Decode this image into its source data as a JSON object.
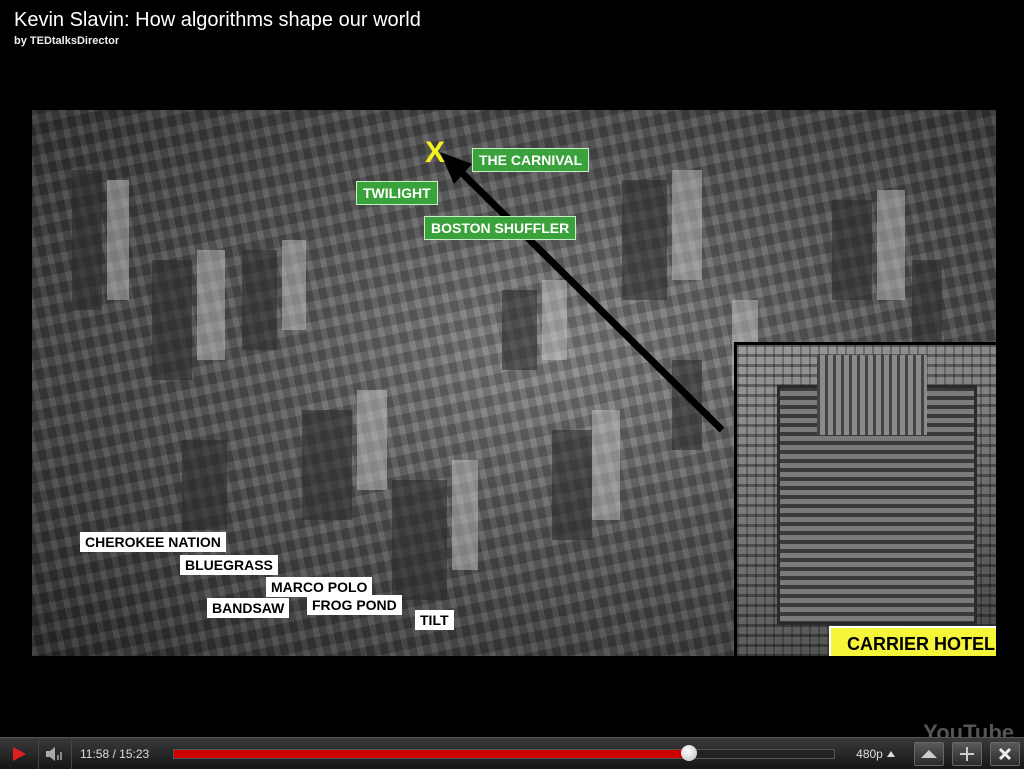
{
  "video": {
    "title": "Kevin Slavin: How algorithms shape our world",
    "author": "by TEDtalksDirector"
  },
  "frame": {
    "marker": "X",
    "labels_green": [
      {
        "text": "THE CARNIVAL"
      },
      {
        "text": "TWILIGHT"
      },
      {
        "text": "BOSTON SHUFFLER"
      }
    ],
    "labels_white": [
      {
        "text": "CHEROKEE NATION"
      },
      {
        "text": "BLUEGRASS"
      },
      {
        "text": "MARCO POLO"
      },
      {
        "text": "BANDSAW"
      },
      {
        "text": "FROG POND"
      },
      {
        "text": "TILT"
      }
    ],
    "inset_label": "CARRIER HOTEL"
  },
  "watermark": "YouTube",
  "player": {
    "current_time": "11:58",
    "separator": "/",
    "duration": "15:23",
    "progress_fraction": 0.78,
    "buffer_fraction": 0.7,
    "quality": "480p",
    "colors": {
      "played": "#cc0000",
      "bar_bg": "#151515"
    },
    "icons": [
      "play-icon",
      "volume-icon",
      "quality-arrow-icon",
      "popout-icon",
      "expand-icon",
      "fullscreen-icon"
    ]
  }
}
